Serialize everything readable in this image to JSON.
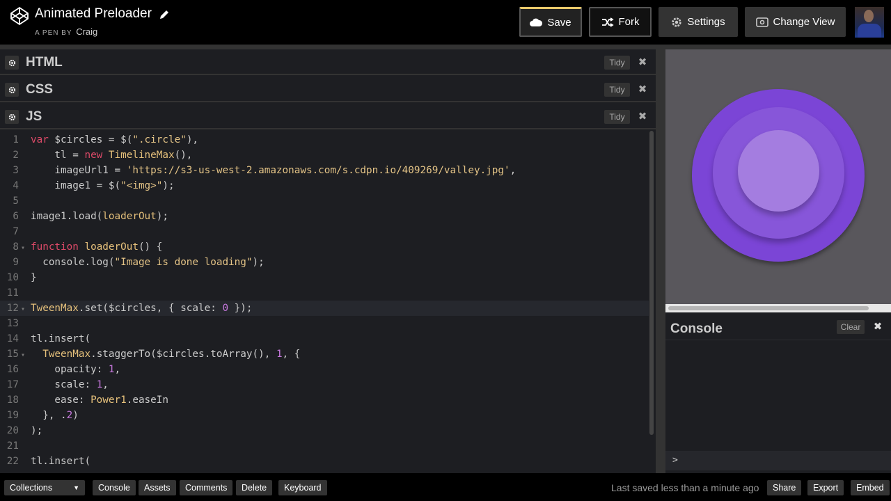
{
  "header": {
    "pen_title": "Animated Preloader",
    "pen_by_label": "A PEN BY",
    "author": "Craig",
    "buttons": {
      "save": "Save",
      "fork": "Fork",
      "settings": "Settings",
      "change_view": "Change View"
    }
  },
  "editors": {
    "panels": [
      {
        "title": "HTML",
        "tidy": "Tidy",
        "close": "✖"
      },
      {
        "title": "CSS",
        "tidy": "Tidy",
        "close": "✖"
      },
      {
        "title": "JS",
        "tidy": "Tidy",
        "close": "✖"
      }
    ]
  },
  "code": {
    "active_line": 12,
    "lines": [
      {
        "n": "1",
        "text": "var $circles = $(\".circle\"),"
      },
      {
        "n": "2",
        "text": "    tl = new TimelineMax(),"
      },
      {
        "n": "3",
        "text": "    imageUrl1 = 'https://s3-us-west-2.amazonaws.com/s.cdpn.io/409269/valley.jpg',"
      },
      {
        "n": "4",
        "text": "    image1 = $(\"<img>\");"
      },
      {
        "n": "5",
        "text": ""
      },
      {
        "n": "6",
        "text": "image1.load(loaderOut);"
      },
      {
        "n": "7",
        "text": ""
      },
      {
        "n": "8",
        "text": "function loaderOut() {"
      },
      {
        "n": "9",
        "text": "  console.log(\"Image is done loading\");"
      },
      {
        "n": "10",
        "text": "}"
      },
      {
        "n": "11",
        "text": ""
      },
      {
        "n": "12",
        "text": "TweenMax.set($circles, { scale: 0 });"
      },
      {
        "n": "13",
        "text": ""
      },
      {
        "n": "14",
        "text": "tl.insert("
      },
      {
        "n": "15",
        "text": "  TweenMax.staggerTo($circles.toArray(), 1, {"
      },
      {
        "n": "16",
        "text": "    opacity: 1,"
      },
      {
        "n": "17",
        "text": "    scale: 1,"
      },
      {
        "n": "18",
        "text": "    ease: Power1.easeIn"
      },
      {
        "n": "19",
        "text": "  }, .2)"
      },
      {
        "n": "20",
        "text": ");"
      },
      {
        "n": "21",
        "text": ""
      },
      {
        "n": "22",
        "text": "tl.insert("
      }
    ]
  },
  "console": {
    "title": "Console",
    "clear": "Clear",
    "close": "✖",
    "prompt": ">"
  },
  "footer": {
    "collections": "Collections",
    "console": "Console",
    "assets": "Assets",
    "comments": "Comments",
    "delete": "Delete",
    "keyboard": "Keyboard",
    "last_saved": "Last saved less than a minute ago",
    "share": "Share",
    "export": "Export",
    "embed": "Embed"
  },
  "colors": {
    "accent_save": "#e8c86a",
    "circle_outer": "#7b45d6",
    "circle_mid": "#8756d9",
    "circle_inner": "#a47de0",
    "preview_bg": "#59575c"
  }
}
